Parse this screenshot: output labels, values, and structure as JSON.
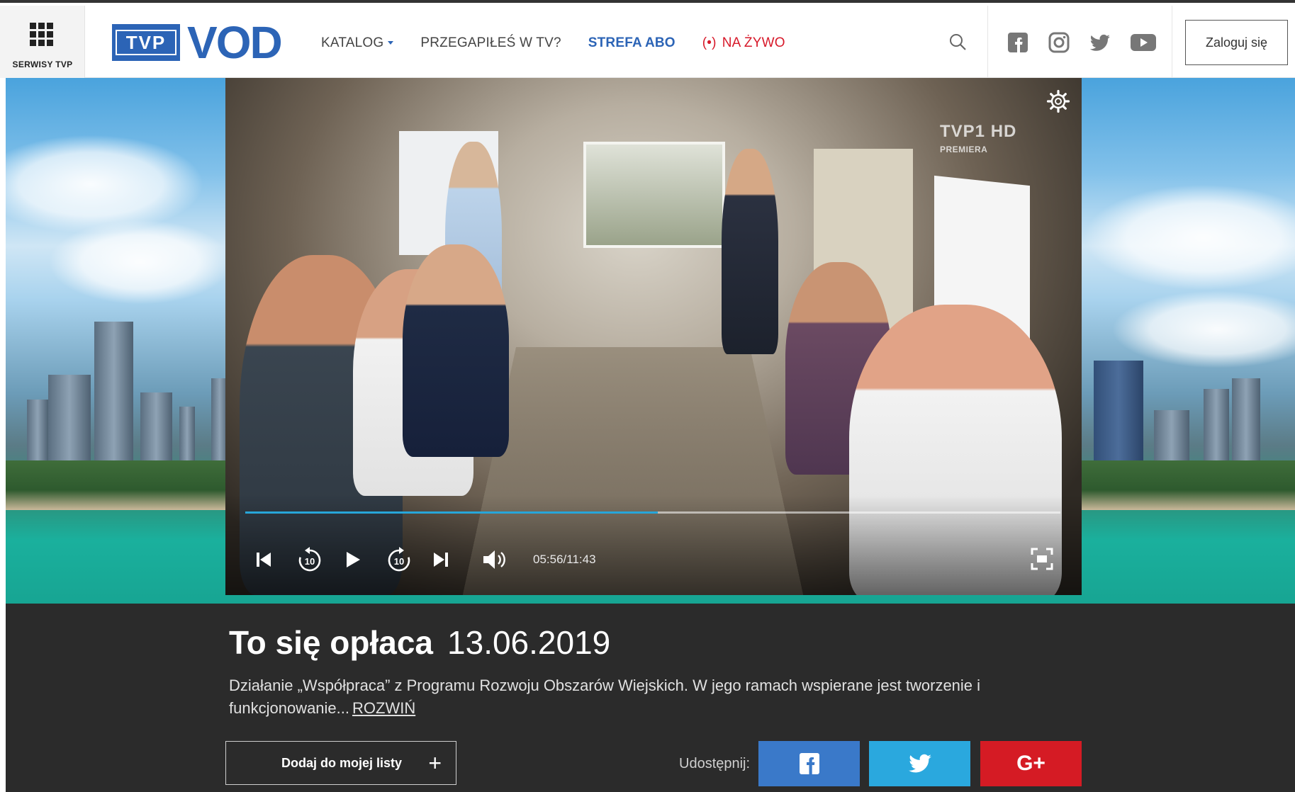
{
  "header": {
    "services_label": "SERWISY TVP",
    "logo_tvp": "TVP",
    "logo_vod": "VOD",
    "nav": [
      {
        "label": "KATALOG"
      },
      {
        "label": "PRZEGAPIŁEŚ W TV?"
      },
      {
        "label": "STREFA ABO"
      },
      {
        "label": "NA ŻYWO",
        "icon": "live-broadcast-icon"
      }
    ],
    "social_icons": [
      "facebook-icon",
      "instagram-icon",
      "twitter-icon",
      "youtube-icon"
    ],
    "login_label": "Zaloguj się"
  },
  "player": {
    "channel": "TVP1 HD",
    "channel_tag": "PREMIERA",
    "current_time": "05:56/11:43",
    "progress_fraction": 0.506,
    "controls": [
      "skip-back-icon",
      "rewind-10-icon",
      "play-icon",
      "forward-10-icon",
      "skip-next-icon",
      "volume-icon",
      "fullscreen-icon",
      "settings-icon"
    ]
  },
  "program": {
    "title": "To się opłaca",
    "date": "13.06.2019",
    "description": "Działanie „Współpraca” z Programu Rozwoju Obszarów Wiejskich. W jego ramach wspierane jest tworzenie i funkcjonowanie...",
    "expand_label": "ROZWIŃ",
    "add_to_list_label": "Dodaj do mojej listy",
    "add_to_list_symbol": "+",
    "share_label": "Udostępnij:"
  },
  "colors": {
    "brand_blue": "#2c64b6",
    "live_red": "#d7192a",
    "progress": "#27a6d9",
    "facebook": "#3a79c9",
    "twitter": "#2aa8de",
    "googleplus": "#d51b24"
  }
}
